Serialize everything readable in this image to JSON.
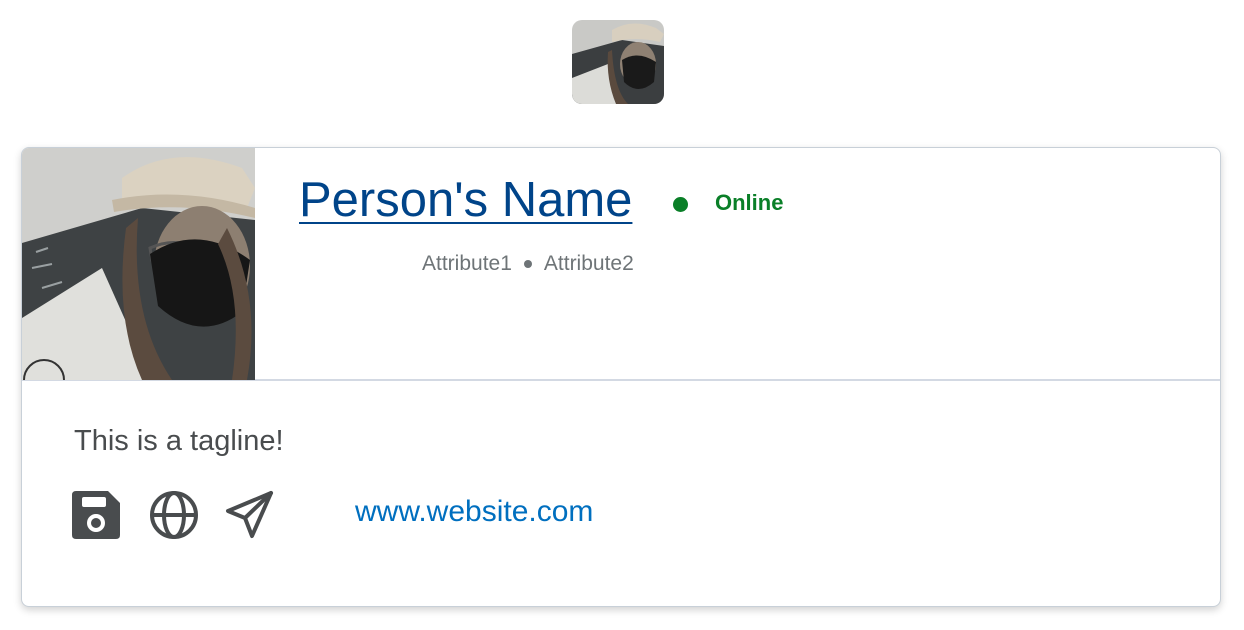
{
  "profile": {
    "name": "Person's Name",
    "presence": "Online",
    "attributes": [
      "Attribute1",
      "Attribute2"
    ],
    "tagline": "This is a tagline!",
    "website": "www.website.com"
  },
  "icons": {
    "contact_buttons": [
      "save-disk-icon",
      "globe-icon",
      "send-paper-plane-icon"
    ]
  },
  "colors": {
    "name_link": "#004489",
    "presence_online": "#0a7f28",
    "website_link": "#006fbf",
    "secondary_text": "#6e7477",
    "body_text": "#494c4e",
    "icon_fill": "#494c4e"
  }
}
